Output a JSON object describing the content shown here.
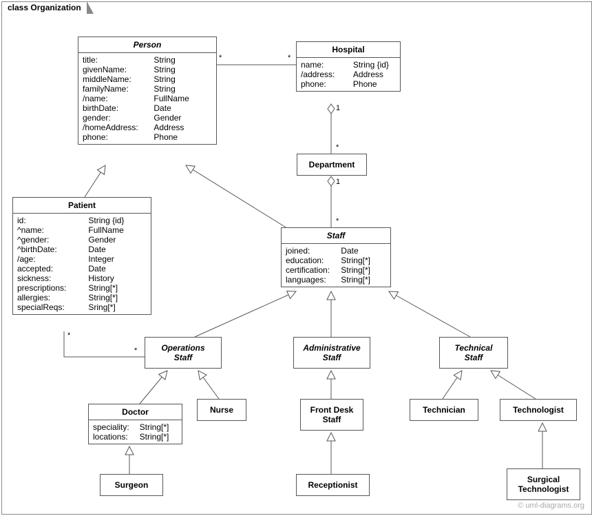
{
  "frame_label": "class Organization",
  "watermark": "© uml-diagrams.org",
  "classes": {
    "person": {
      "title": "Person",
      "attrs": [
        {
          "n": "title:",
          "t": "String"
        },
        {
          "n": "givenName:",
          "t": "String"
        },
        {
          "n": "middleName:",
          "t": "String"
        },
        {
          "n": "familyName:",
          "t": "String"
        },
        {
          "n": "/name:",
          "t": "FullName"
        },
        {
          "n": "birthDate:",
          "t": "Date"
        },
        {
          "n": "gender:",
          "t": "Gender"
        },
        {
          "n": "/homeAddress:",
          "t": "Address"
        },
        {
          "n": "phone:",
          "t": "Phone"
        }
      ]
    },
    "hospital": {
      "title": "Hospital",
      "attrs": [
        {
          "n": "name:",
          "t": "String {id}"
        },
        {
          "n": "/address:",
          "t": "Address"
        },
        {
          "n": "phone:",
          "t": "Phone"
        }
      ]
    },
    "department": {
      "title": "Department"
    },
    "patient": {
      "title": "Patient",
      "attrs": [
        {
          "n": "id:",
          "t": "String {id}"
        },
        {
          "n": "^name:",
          "t": "FullName"
        },
        {
          "n": "^gender:",
          "t": "Gender"
        },
        {
          "n": "^birthDate:",
          "t": "Date"
        },
        {
          "n": "/age:",
          "t": "Integer"
        },
        {
          "n": "accepted:",
          "t": "Date"
        },
        {
          "n": "sickness:",
          "t": "History"
        },
        {
          "n": "prescriptions:",
          "t": "String[*]"
        },
        {
          "n": "allergies:",
          "t": "String[*]"
        },
        {
          "n": "specialReqs:",
          "t": "Sring[*]"
        }
      ]
    },
    "staff": {
      "title": "Staff",
      "attrs": [
        {
          "n": "joined:",
          "t": "Date"
        },
        {
          "n": "education:",
          "t": "String[*]"
        },
        {
          "n": "certification:",
          "t": "String[*]"
        },
        {
          "n": "languages:",
          "t": "String[*]"
        }
      ]
    },
    "opsstaff": {
      "title": "Operations\nStaff"
    },
    "adminstaff": {
      "title": "Administrative\nStaff"
    },
    "techstaff": {
      "title": "Technical\nStaff"
    },
    "doctor": {
      "title": "Doctor",
      "attrs": [
        {
          "n": "speciality:",
          "t": "String[*]"
        },
        {
          "n": "locations:",
          "t": "String[*]"
        }
      ]
    },
    "nurse": {
      "title": "Nurse"
    },
    "frontdesk": {
      "title": "Front Desk\nStaff"
    },
    "technician": {
      "title": "Technician"
    },
    "technologist": {
      "title": "Technologist"
    },
    "surgeon": {
      "title": "Surgeon"
    },
    "receptionist": {
      "title": "Receptionist"
    },
    "surgtech": {
      "title": "Surgical\nTechnologist"
    }
  },
  "multiplicities": {
    "ph_p": "*",
    "ph_h": "*",
    "hd_h": "1",
    "hd_d": "*",
    "ds_d": "1",
    "ds_s": "*",
    "po_p": "*",
    "po_o": "*"
  }
}
